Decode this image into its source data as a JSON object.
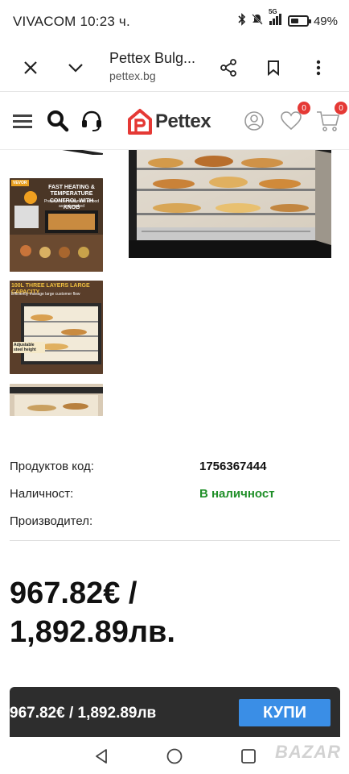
{
  "status_bar": {
    "time": "VIVACOM 10:23 ч.",
    "network": "5G",
    "battery": "49%",
    "battery_level": 0.49
  },
  "browser": {
    "title": "Pettex Bulg...",
    "url": "pettex.bg",
    "icons": [
      "close-icon",
      "chevron-down-icon",
      "share-icon",
      "bookmark-icon",
      "more-vert-icon"
    ]
  },
  "site_header": {
    "logo_text": "Pettex",
    "wishlist_count": "0",
    "cart_count": "0",
    "icons": [
      "menu-icon",
      "search-icon",
      "headset-icon",
      "user-icon",
      "heart-icon",
      "cart-icon"
    ],
    "brand_color": "#e53935"
  },
  "gallery": {
    "thumbs": [
      {
        "caption": "FAST HEATING & TEMPERATURE CONTROL WITH KNOB",
        "sub": "Preserve the freshness of food as just cooked",
        "brand": "VEVOR"
      },
      {
        "caption": "100L THREE LAYERS LARGE CAPACITY",
        "sub": "Efficiently manage large customer flow",
        "note": "Adjustable steel height"
      },
      {
        "caption": ""
      }
    ]
  },
  "details": {
    "rows": [
      {
        "label": "Продуктов код:",
        "value": "1756367444"
      },
      {
        "label": "Наличност:",
        "value": "В наличност"
      },
      {
        "label": "Производител:",
        "value": ""
      }
    ],
    "stock_color": "#1f8f28"
  },
  "price": {
    "line1": "967.82€ /",
    "line2": "1,892.89лв."
  },
  "buy_bar": {
    "price": "967.82€ / 1,892.89лв",
    "button": "КУПИ",
    "button_color": "#3a8ee6"
  },
  "nav": {
    "icons": [
      "back-icon",
      "home-icon",
      "recents-icon"
    ],
    "watermark": "BAZAR"
  }
}
